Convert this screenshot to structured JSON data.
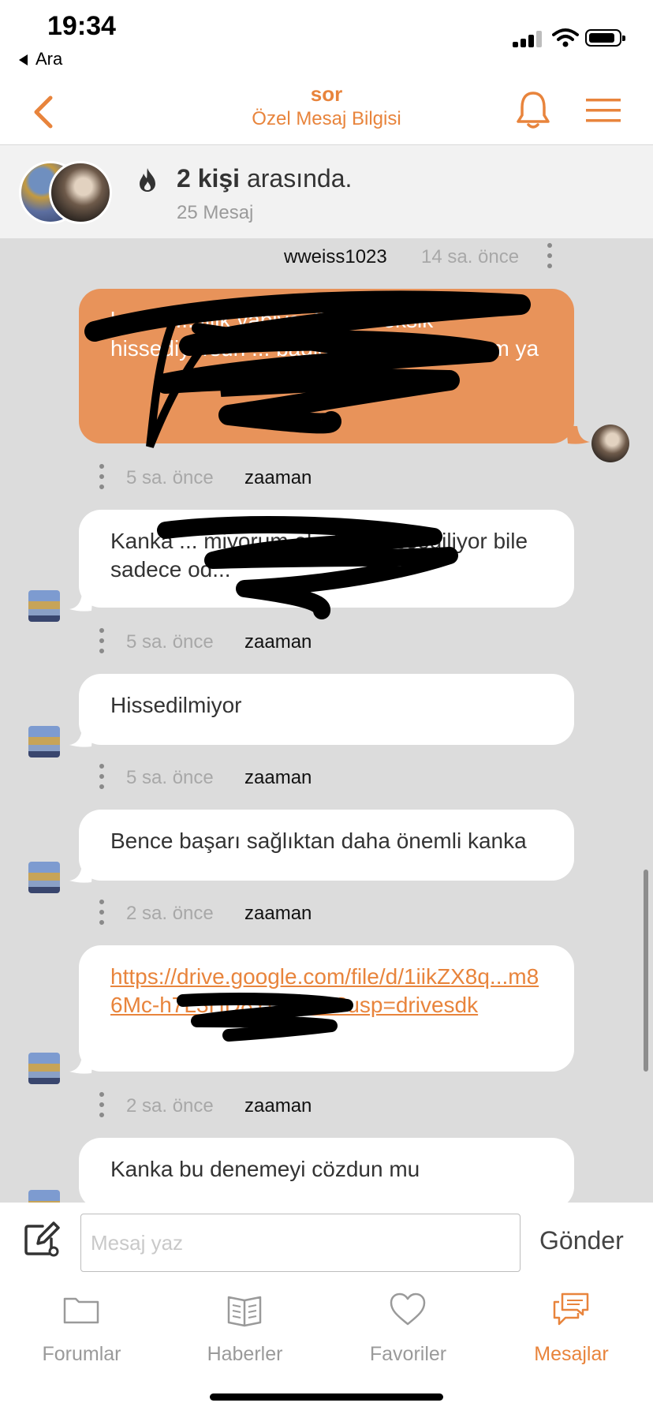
{
  "status_bar": {
    "time": "19:34",
    "back_app": "Ara"
  },
  "header": {
    "title": "sor",
    "subtitle": "Özel Mesaj Bilgisi"
  },
  "conversation": {
    "people_count": "2 kişi",
    "people_suffix": " arasında.",
    "message_count": "25 Mesaj"
  },
  "messages": [
    {
      "user": "wweiss1023",
      "time": "14 sa. önce",
      "text": "kanka ... lilik yapiyo diyol ... eksik hissediyorsun ... bağlanmak istemiyorum ya",
      "redacted": true,
      "own": true
    },
    {
      "user": "zaaman",
      "time": "5 sa. önce",
      "text": "Kanka ... miyorum eksikliği hissediliyor bile sadece od...",
      "redacted": true
    },
    {
      "user": "zaaman",
      "time": "5 sa. önce",
      "text": "Hissedilmiyor"
    },
    {
      "user": "zaaman",
      "time": "5 sa. önce",
      "text": "Bence başarı sağlıktan daha önemli kanka"
    },
    {
      "user": "zaaman",
      "time": "2 sa. önce",
      "link": "https://drive.google.com/file/d/1iikZX8q...m86Mc-h7L3HD8YO/view?usp=drivesdk",
      "redacted": true
    },
    {
      "user": "zaaman",
      "time": "2 sa. önce",
      "text": "Kanka bu denemeyi cözdun mu"
    }
  ],
  "compose": {
    "placeholder": "Mesaj yaz",
    "send_label": "Gönder"
  },
  "tabs": [
    {
      "label": "Forumlar",
      "icon": "folder-icon"
    },
    {
      "label": "Haberler",
      "icon": "newspaper-icon"
    },
    {
      "label": "Favoriler",
      "icon": "heart-icon"
    },
    {
      "label": "Mesajlar",
      "icon": "messages-icon",
      "active": true
    }
  ],
  "colors": {
    "accent": "#e8843c",
    "own_bubble": "#e8935a",
    "chat_bg": "#dcdcdc",
    "info_bg": "#f2f2f2"
  }
}
